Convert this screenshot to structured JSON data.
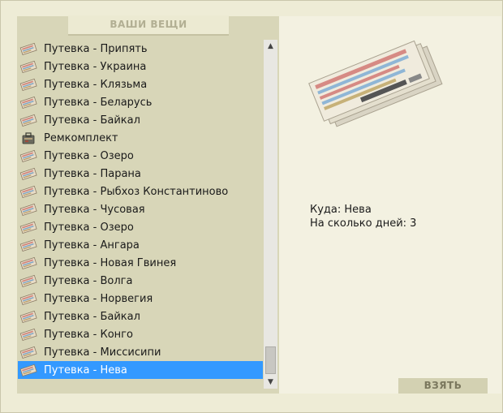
{
  "window": {
    "tab_title": "ВАШИ ВЕЩИ"
  },
  "items": [
    {
      "label": "Путевка - Припять",
      "icon": "ticket-icon"
    },
    {
      "label": "Путевка - Украина",
      "icon": "ticket-icon"
    },
    {
      "label": "Путевка - Клязьма",
      "icon": "ticket-icon"
    },
    {
      "label": "Путевка - Беларусь",
      "icon": "ticket-icon"
    },
    {
      "label": "Путевка - Байкал",
      "icon": "ticket-icon"
    },
    {
      "label": "Ремкомплект",
      "icon": "repair-kit-icon"
    },
    {
      "label": "Путевка - Озеро",
      "icon": "ticket-icon"
    },
    {
      "label": "Путевка - Парана",
      "icon": "ticket-icon"
    },
    {
      "label": "Путевка - Рыбхоз Константиново",
      "icon": "ticket-icon"
    },
    {
      "label": "Путевка - Чусовая",
      "icon": "ticket-icon"
    },
    {
      "label": "Путевка - Озеро",
      "icon": "ticket-icon"
    },
    {
      "label": "Путевка - Ангара",
      "icon": "ticket-icon"
    },
    {
      "label": "Путевка - Новая Гвинея",
      "icon": "ticket-icon"
    },
    {
      "label": "Путевка - Волга",
      "icon": "ticket-icon"
    },
    {
      "label": "Путевка - Норвегия",
      "icon": "ticket-icon"
    },
    {
      "label": "Путевка - Байкал",
      "icon": "ticket-icon"
    },
    {
      "label": "Путевка - Конго",
      "icon": "ticket-icon"
    },
    {
      "label": "Путевка - Миссисипи",
      "icon": "ticket-icon"
    },
    {
      "label": "Путевка - Нева",
      "icon": "ticket-icon",
      "selected": true
    }
  ],
  "scrollbar": {
    "position_fraction": 0.88
  },
  "detail": {
    "destination": "Куда: Нева",
    "days": "На сколько дней: 3"
  },
  "take_button": {
    "label": "ВЗЯТЬ"
  },
  "colors": {
    "selection": "#3399ff",
    "list_background": "#d8d6b8",
    "detail_background": "#f3f1e1"
  }
}
